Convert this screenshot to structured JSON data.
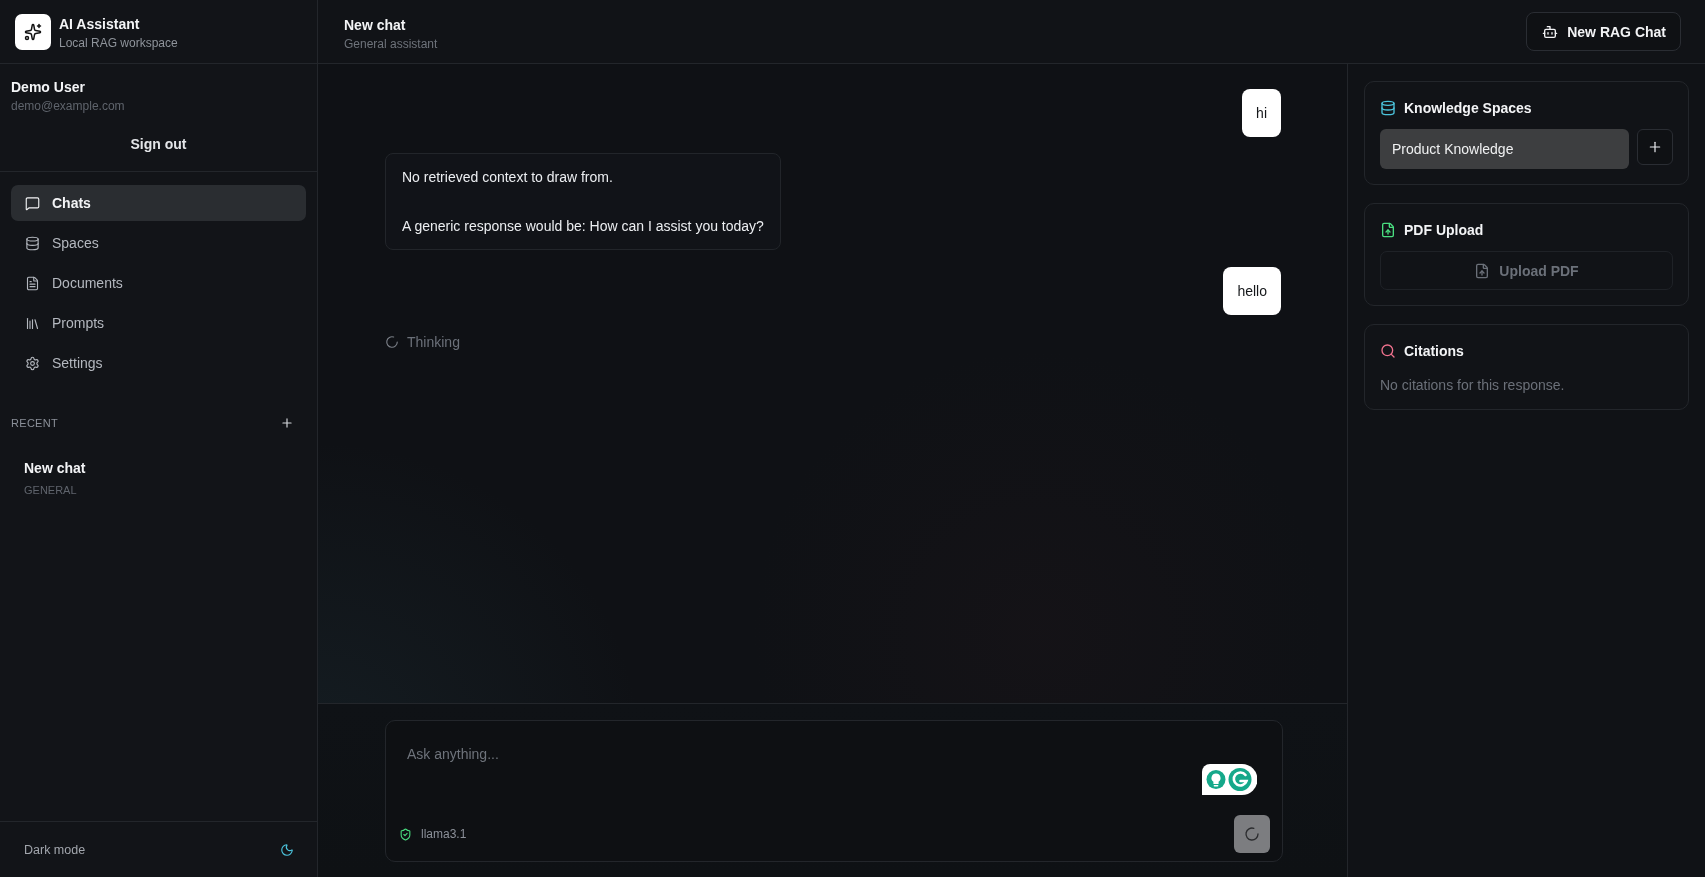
{
  "sidebar": {
    "brand": {
      "title": "AI Assistant",
      "subtitle": "Local RAG workspace"
    },
    "user": {
      "name": "Demo User",
      "email": "demo@example.com",
      "sign_out": "Sign out"
    },
    "nav": [
      {
        "label": "Chats",
        "selected": true
      },
      {
        "label": "Spaces",
        "selected": false
      },
      {
        "label": "Documents",
        "selected": false
      },
      {
        "label": "Prompts",
        "selected": false
      },
      {
        "label": "Settings",
        "selected": false
      }
    ],
    "recent": {
      "heading": "RECENT",
      "items": [
        {
          "title": "New chat",
          "tag": "GENERAL",
          "selected": false
        }
      ]
    },
    "theme_toggle": {
      "label": "Dark mode"
    }
  },
  "header": {
    "title": "New chat",
    "subtitle": "General assistant",
    "new_chat_button": "New RAG Chat"
  },
  "messages": [
    {
      "kind": "user",
      "paragraphs": [
        "hi"
      ]
    },
    {
      "kind": "assistant",
      "paragraphs": [
        "No retrieved context to draw from.",
        "A generic response would be: How can I assist you today?"
      ]
    },
    {
      "kind": "user",
      "paragraphs": [
        "hello"
      ]
    }
  ],
  "status": {
    "text": "Thinking"
  },
  "composer": {
    "placeholder": "Ask anything...",
    "model": "llama3.1"
  },
  "panels": {
    "knowledge_spaces": {
      "title": "Knowledge Spaces",
      "selected_space": "Product Knowledge"
    },
    "pdf_upload": {
      "title": "PDF Upload",
      "button": "Upload PDF",
      "disabled": true
    },
    "citations": {
      "title": "Citations",
      "empty_text": "No citations for this response."
    }
  }
}
